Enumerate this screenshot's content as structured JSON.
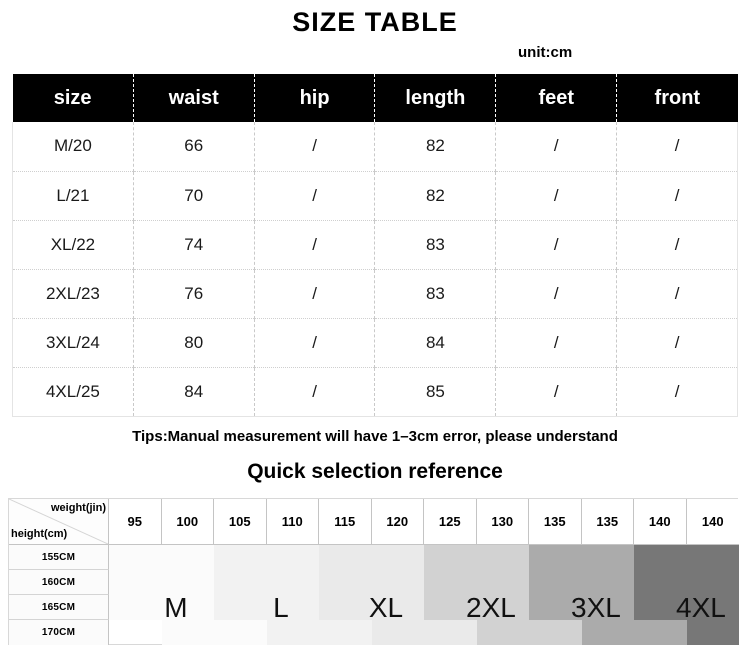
{
  "title": "SIZE  TABLE",
  "unit_label": "unit:cm",
  "size_table": {
    "columns": [
      "size",
      "waist",
      "hip",
      "length",
      "feet",
      "front"
    ],
    "rows": [
      {
        "size": "M/20",
        "waist": "66",
        "hip": "/",
        "length": "82",
        "feet": "/",
        "front": "/"
      },
      {
        "size": "L/21",
        "waist": "70",
        "hip": "/",
        "length": "82",
        "feet": "/",
        "front": "/"
      },
      {
        "size": "XL/22",
        "waist": "74",
        "hip": "/",
        "length": "83",
        "feet": "/",
        "front": "/"
      },
      {
        "size": "2XL/23",
        "waist": "76",
        "hip": "/",
        "length": "83",
        "feet": "/",
        "front": "/"
      },
      {
        "size": "3XL/24",
        "waist": "80",
        "hip": "/",
        "length": "84",
        "feet": "/",
        "front": "/"
      },
      {
        "size": "4XL/25",
        "waist": "84",
        "hip": "/",
        "length": "85",
        "feet": "/",
        "front": "/"
      }
    ]
  },
  "tips_text": "Tips:Manual measurement will have 1–3cm error, please understand",
  "quick_reference": {
    "heading": "Quick selection reference",
    "corner": {
      "weight_axis_label": "weight(jin)",
      "height_axis_label": "height(cm)"
    },
    "weight_columns": [
      "95",
      "100",
      "105",
      "110",
      "115",
      "120",
      "125",
      "130",
      "135",
      "135",
      "140",
      "140"
    ],
    "height_rows": [
      "155CM",
      "160CM",
      "165CM",
      "170CM"
    ],
    "size_blocks": [
      {
        "label": "M",
        "color": "#fbfbfb",
        "col_start": 0,
        "col_span": 2,
        "step_col_span": 1
      },
      {
        "label": "L",
        "color": "#f2f2f2",
        "col_start": 2,
        "col_span": 2,
        "step_col_span": 1
      },
      {
        "label": "XL",
        "color": "#eaeaea",
        "col_start": 4,
        "col_span": 2,
        "step_col_span": 1
      },
      {
        "label": "2XL",
        "color": "#d2d2d2",
        "col_start": 6,
        "col_span": 2,
        "step_col_span": 1
      },
      {
        "label": "3XL",
        "color": "#ababab",
        "col_start": 8,
        "col_span": 2,
        "step_col_span": 1
      },
      {
        "label": "4XL",
        "color": "#777777",
        "col_start": 10,
        "col_span": 2,
        "step_col_span": 1
      }
    ],
    "colors": {
      "m": "#fbfbfb",
      "l": "#f2f2f2",
      "xl": "#eaeaea",
      "xxl": "#d2d2d2",
      "xxxl": "#ababab",
      "xxxxl": "#777777",
      "header_black": "#000000",
      "grid_border": "#c4c4c4"
    }
  }
}
